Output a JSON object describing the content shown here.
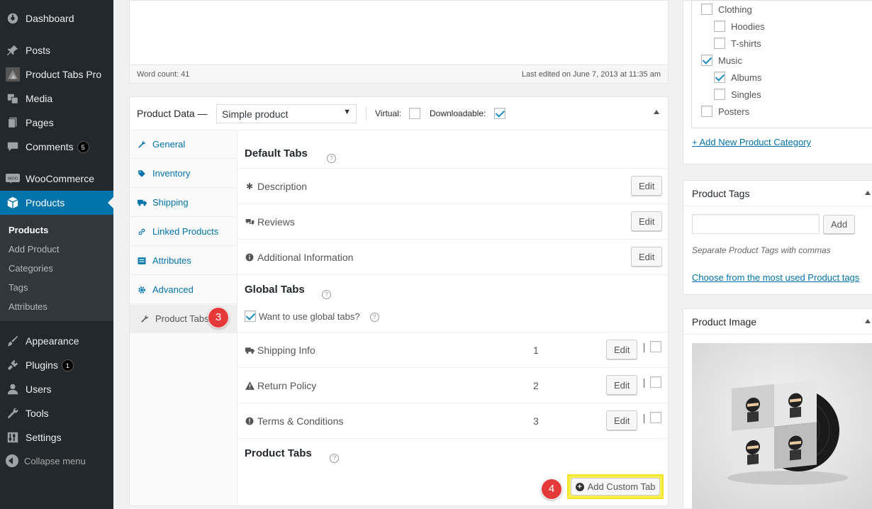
{
  "sidebar": {
    "items": [
      {
        "label": "Dashboard",
        "icon": "dashboard-icon"
      },
      {
        "label": "Posts",
        "icon": "pin-icon"
      },
      {
        "label": "Product Tabs Pro",
        "icon": "product-tabs-pro-logo-icon"
      },
      {
        "label": "Media",
        "icon": "media-icon"
      },
      {
        "label": "Pages",
        "icon": "pages-icon"
      },
      {
        "label": "Comments",
        "icon": "comment-icon",
        "badge": "5"
      },
      {
        "label": "WooCommerce",
        "icon": "woocommerce-icon"
      },
      {
        "label": "Products",
        "icon": "cube-icon"
      },
      {
        "label": "Appearance",
        "icon": "paintbrush-icon"
      },
      {
        "label": "Plugins",
        "icon": "plug-icon",
        "badge": "1"
      },
      {
        "label": "Users",
        "icon": "user-icon"
      },
      {
        "label": "Tools",
        "icon": "wrench-icon"
      },
      {
        "label": "Settings",
        "icon": "sliders-icon"
      }
    ],
    "submenu": [
      "Products",
      "Add Product",
      "Categories",
      "Tags",
      "Attributes"
    ],
    "collapse_label": "Collapse menu"
  },
  "editor": {
    "word_count": "Word count: 41",
    "last_edited": "Last edited on June 7, 2013 at 11:35 am"
  },
  "product_data": {
    "title": "Product Data —",
    "type_value": "Simple product",
    "virtual_label": "Virtual:",
    "virtual_checked": false,
    "downloadable_label": "Downloadable:",
    "downloadable_checked": true,
    "tabs": [
      "General",
      "Inventory",
      "Shipping",
      "Linked Products",
      "Attributes",
      "Advanced",
      "Product Tabs"
    ],
    "active_tab": "Product Tabs"
  },
  "panel": {
    "default_title": "Default Tabs",
    "default_tabs": [
      {
        "label": "Description",
        "icon": "asterisk-icon"
      },
      {
        "label": "Reviews",
        "icon": "comments-icon"
      },
      {
        "label": "Additional Information",
        "icon": "info-circle-icon"
      }
    ],
    "edit_label": "Edit",
    "global_title": "Global Tabs",
    "global_question": "Want to use global tabs?",
    "global_question_checked": true,
    "global_tabs": [
      {
        "label": "Shipping Info",
        "icon": "truck-icon",
        "order": "1"
      },
      {
        "label": "Return Policy",
        "icon": "warning-icon",
        "order": "2"
      },
      {
        "label": "Terms & Conditions",
        "icon": "exclamation-circle-icon",
        "order": "3"
      }
    ],
    "product_tabs_title": "Product Tabs",
    "add_custom_tab": "Add Custom Tab",
    "help_glyph": "?"
  },
  "steps": {
    "step3": "3",
    "step4": "4"
  },
  "categories": {
    "items": [
      {
        "label": "Clothing",
        "checked": false,
        "level": 0
      },
      {
        "label": "Hoodies",
        "checked": false,
        "level": 1
      },
      {
        "label": "T-shirts",
        "checked": false,
        "level": 1
      },
      {
        "label": "Music",
        "checked": true,
        "level": 0
      },
      {
        "label": "Albums",
        "checked": true,
        "level": 1
      },
      {
        "label": "Singles",
        "checked": false,
        "level": 1
      },
      {
        "label": "Posters",
        "checked": false,
        "level": 0
      }
    ],
    "add_new": "+ Add New Product Category"
  },
  "tags": {
    "title": "Product Tags",
    "input_value": "",
    "add_button": "Add",
    "hint": "Separate Product Tags with commas",
    "choose_link": "Choose from the most used Product tags"
  },
  "image": {
    "title": "Product Image"
  },
  "colors": {
    "sidebar_bg": "#23282d",
    "active_blue": "#0073aa",
    "highlight_yellow": "#f7f050",
    "step_red": "#e53a3a"
  }
}
